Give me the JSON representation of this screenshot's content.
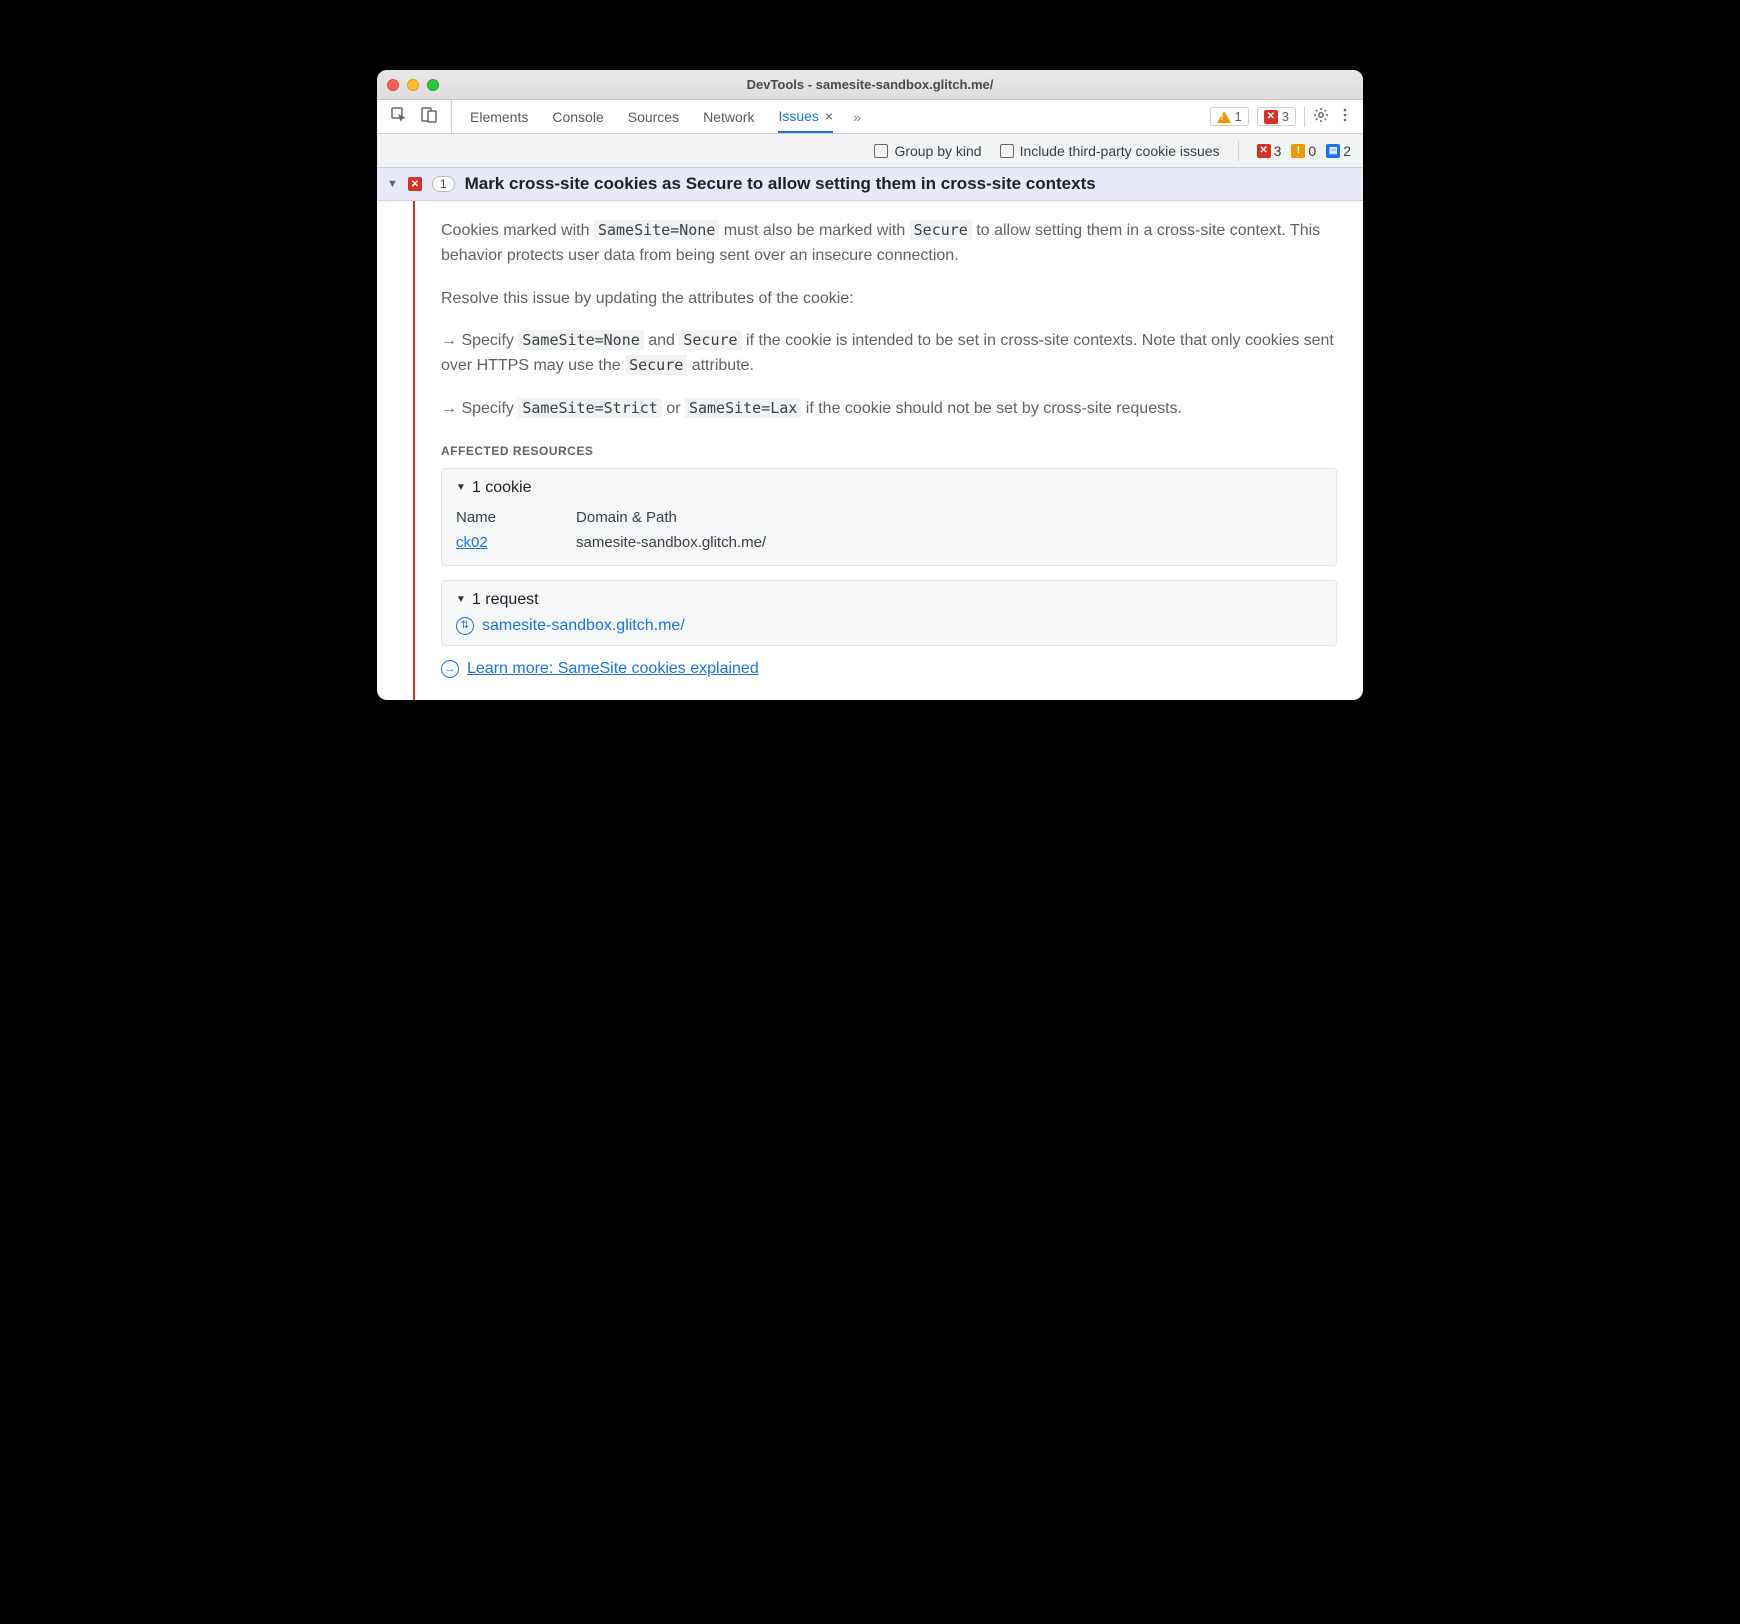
{
  "window": {
    "title": "DevTools - samesite-sandbox.glitch.me/"
  },
  "tabs": {
    "items": [
      "Elements",
      "Console",
      "Sources",
      "Network",
      "Issues"
    ],
    "active": "Issues"
  },
  "toolbar_right": {
    "warning_count": "1",
    "error_count": "3"
  },
  "filter": {
    "group_by_kind": "Group by kind",
    "include_third_party": "Include third-party cookie issues",
    "errors": "3",
    "warnings": "0",
    "info": "2"
  },
  "issue": {
    "count": "1",
    "title": "Mark cross-site cookies as Secure to allow setting them in cross-site contexts",
    "p1_pre": "Cookies marked with ",
    "p1_code1": "SameSite=None",
    "p1_mid": " must also be marked with ",
    "p1_code2": "Secure",
    "p1_post": " to allow setting them in a cross-site context. This behavior protects user data from being sent over an insecure connection.",
    "p2": "Resolve this issue by updating the attributes of the cookie:",
    "b1_pre": "Specify ",
    "b1_code1": "SameSite=None",
    "b1_mid": " and ",
    "b1_code2": "Secure",
    "b1_post": " if the cookie is intended to be set in cross-site contexts. Note that only cookies sent over HTTPS may use the ",
    "b1_code3": "Secure",
    "b1_tail": " attribute.",
    "b2_pre": "Specify ",
    "b2_code1": "SameSite=Strict",
    "b2_mid": " or ",
    "b2_code2": "SameSite=Lax",
    "b2_post": " if the cookie should not be set by cross-site requests.",
    "affected_label": "Affected Resources",
    "cookie_section": "1 cookie",
    "cookie_col_name": "Name",
    "cookie_col_domain": "Domain & Path",
    "cookie_name": "ck02",
    "cookie_domain": "samesite-sandbox.glitch.me/",
    "request_section": "1 request",
    "request_url": "samesite-sandbox.glitch.me/",
    "learn_more": "Learn more: SameSite cookies explained"
  }
}
